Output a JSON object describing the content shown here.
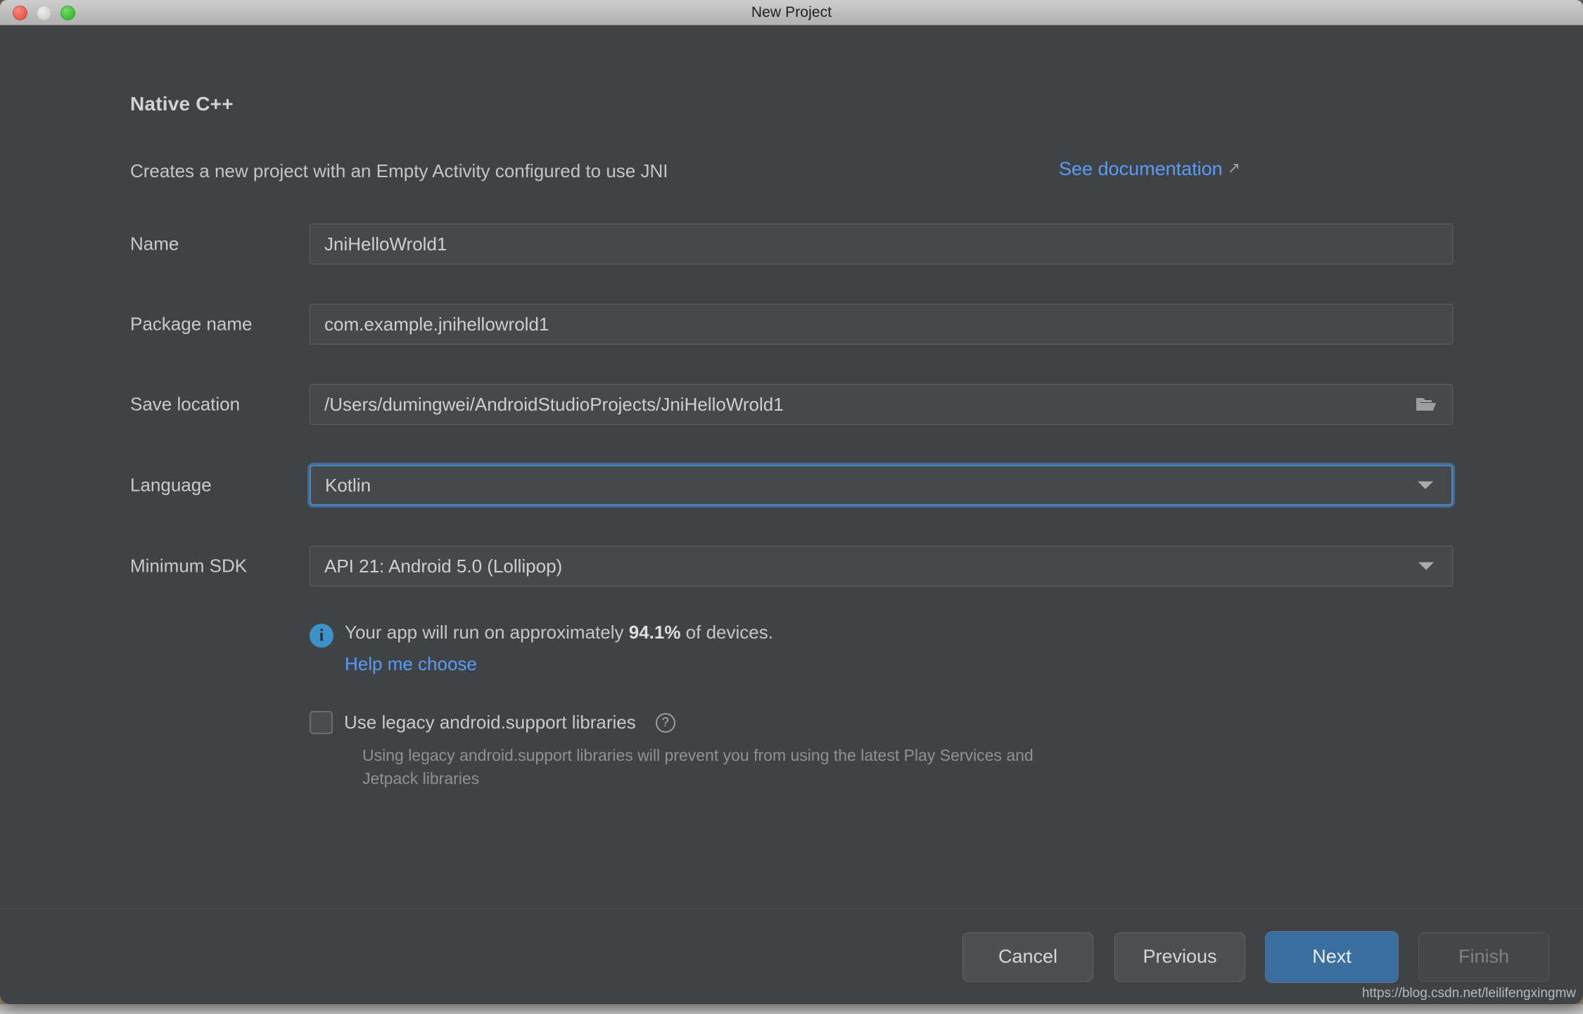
{
  "window": {
    "title": "New Project",
    "traffic_lights": [
      "close",
      "minimize",
      "zoom"
    ]
  },
  "template": {
    "title": "Native C++",
    "description": "Creates a new project with an Empty Activity configured to use JNI",
    "doc_link": "See documentation",
    "doc_link_arrow": "↗"
  },
  "form": {
    "name": {
      "label": "Name",
      "value": "JniHelloWrold1"
    },
    "package_name": {
      "label": "Package name",
      "value": "com.example.jnihellowrold1"
    },
    "save_location": {
      "label": "Save location",
      "value": "/Users/dumingwei/AndroidStudioProjects/JniHelloWrold1",
      "browse_icon": "folder-icon"
    },
    "language": {
      "label": "Language",
      "value": "Kotlin",
      "focused": true,
      "icon": "chevron-down-icon"
    },
    "minimum_sdk": {
      "label": "Minimum SDK",
      "value": "API 21: Android 5.0 (Lollipop)",
      "icon": "chevron-down-icon"
    }
  },
  "info": {
    "icon": "info-icon",
    "icon_glyph": "i",
    "text_before": "Your app will run on approximately ",
    "percent": "94.1%",
    "text_after": " of devices.",
    "help_link": "Help me choose"
  },
  "legacy": {
    "label": "Use legacy android.support libraries",
    "checked": false,
    "help_icon_glyph": "?",
    "hint": "Using legacy android.support libraries will prevent you from using the latest Play Services and Jetpack libraries"
  },
  "footer": {
    "cancel": "Cancel",
    "previous": "Previous",
    "next": "Next",
    "finish": "Finish"
  },
  "watermark": "https://blog.csdn.net/leilifengxingmw",
  "colors": {
    "dialog_bg": "#3f4346",
    "field_bg": "#45494c",
    "accent_blue": "#3c6e9f",
    "link_blue": "#5b9bf8",
    "focus_ring": "#4a88c7",
    "info_icon": "#3d92c9"
  }
}
